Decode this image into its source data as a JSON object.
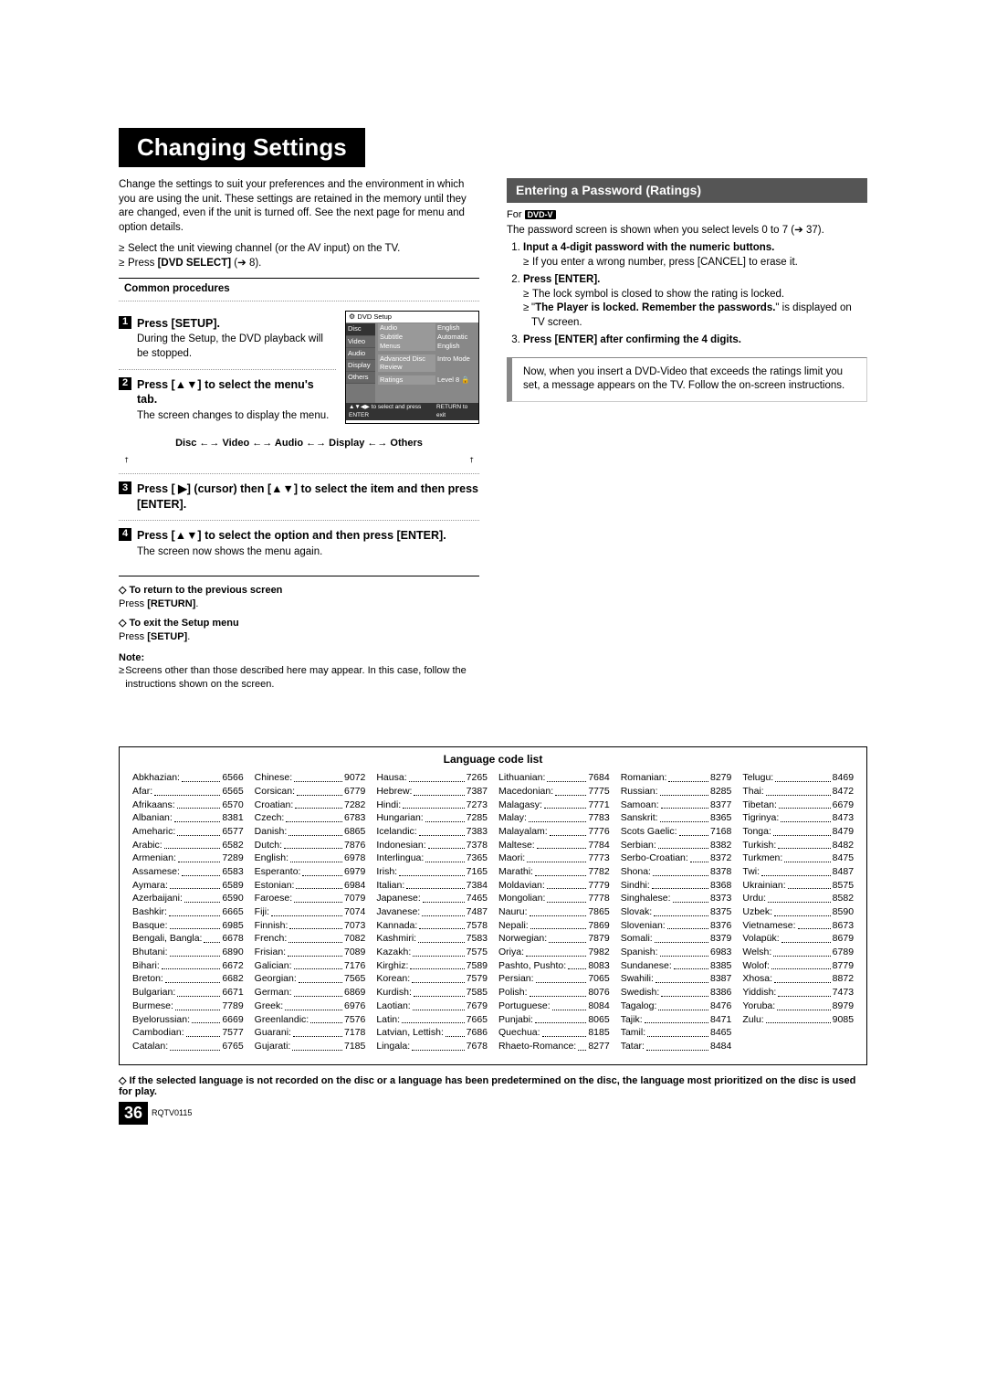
{
  "title": "Changing Settings",
  "intro": "Change the settings to suit your preferences and the environment in which you are using the unit. These settings are retained in the memory until they are changed, even if the unit is turned off. See the next page for menu and option details.",
  "intro_bullets": [
    "Select the unit viewing channel (or the AV input) on the TV.",
    "Press [DVD SELECT] (➔ 8)."
  ],
  "common_header": "Common procedures",
  "steps": [
    {
      "num": "1",
      "title": "Press [SETUP].",
      "body": "During the Setup, the DVD playback will be stopped."
    },
    {
      "num": "2",
      "title": "Press [▲▼] to select the menu's tab.",
      "body": "The screen changes to display the menu."
    },
    {
      "num": "3",
      "title": "Press [ ▶] (cursor) then [▲▼] to select the item and then press [ENTER].",
      "body": ""
    },
    {
      "num": "4",
      "title": "Press [▲▼] to select the option and then press [ENTER].",
      "body": "The screen now shows the menu again."
    }
  ],
  "flow": "Disc ←→ Video ←→ Audio ←→ Display ←→ Others",
  "returns": [
    {
      "head": "To return to the previous screen",
      "body": "Press [RETURN]."
    },
    {
      "head": "To exit the Setup menu",
      "body": "Press [SETUP]."
    }
  ],
  "note_label": "Note:",
  "note_body": "Screens other than those described here may appear. In this case, follow the instructions shown on the screen.",
  "osd": {
    "title": "DVD Setup",
    "tabs": [
      "Disc",
      "Video",
      "Audio",
      "Display",
      "Others"
    ],
    "lines": [
      {
        "label": "Audio",
        "value": "English"
      },
      {
        "label": "Subtitle",
        "value": "Automatic"
      },
      {
        "label": "Menus",
        "value": "English"
      },
      {
        "label": "Advanced Disc Review",
        "value": "Intro Mode"
      },
      {
        "label": "Ratings",
        "value": "Level 8 🔒"
      }
    ],
    "foot_left": "▲▼◀▶ to select and press ENTER",
    "foot_right": "RETURN to exit"
  },
  "right": {
    "heading": "Entering a Password (Ratings)",
    "for_label": "For",
    "dvdv": "DVD-V",
    "lead": "The password screen is shown when you select levels 0 to 7 (➔ 37).",
    "steps": [
      {
        "title": "Input a 4-digit password with the numeric buttons.",
        "subs": [
          "If you enter a wrong number, press [CANCEL] to erase it."
        ]
      },
      {
        "title": "Press [ENTER].",
        "subs": [
          "The lock symbol is closed to show the rating is locked.",
          "\"The Player is locked. Remember the passwords.\" is displayed on TV screen."
        ]
      },
      {
        "title": "Press [ENTER] after confirming the 4 digits.",
        "subs": []
      }
    ],
    "inset": "Now, when you insert a DVD-Video that exceeds the ratings limit you set, a message appears on the TV. Follow the on-screen instructions."
  },
  "lang_title": "Language code list",
  "languages": [
    [
      [
        "Abkhazian:",
        "6566"
      ],
      [
        "Afar:",
        "6565"
      ],
      [
        "Afrikaans:",
        "6570"
      ],
      [
        "Albanian:",
        "8381"
      ],
      [
        "Ameharic:",
        "6577"
      ],
      [
        "Arabic:",
        "6582"
      ],
      [
        "Armenian:",
        "7289"
      ],
      [
        "Assamese:",
        "6583"
      ],
      [
        "Aymara:",
        "6589"
      ],
      [
        "Azerbaijani:",
        "6590"
      ],
      [
        "Bashkir:",
        "6665"
      ],
      [
        "Basque:",
        "6985"
      ],
      [
        "Bengali, Bangla:",
        "6678"
      ],
      [
        "Bhutani:",
        "6890"
      ],
      [
        "Bihari:",
        "6672"
      ],
      [
        "Breton:",
        "6682"
      ],
      [
        "Bulgarian:",
        "6671"
      ],
      [
        "Burmese:",
        "7789"
      ],
      [
        "Byelorussian:",
        "6669"
      ],
      [
        "Cambodian:",
        "7577"
      ],
      [
        "Catalan:",
        "6765"
      ]
    ],
    [
      [
        "Chinese:",
        "9072"
      ],
      [
        "Corsican:",
        "6779"
      ],
      [
        "Croatian:",
        "7282"
      ],
      [
        "Czech:",
        "6783"
      ],
      [
        "Danish:",
        "6865"
      ],
      [
        "Dutch:",
        "7876"
      ],
      [
        "English:",
        "6978"
      ],
      [
        "Esperanto:",
        "6979"
      ],
      [
        "Estonian:",
        "6984"
      ],
      [
        "Faroese:",
        "7079"
      ],
      [
        "Fiji:",
        "7074"
      ],
      [
        "Finnish:",
        "7073"
      ],
      [
        "French:",
        "7082"
      ],
      [
        "Frisian:",
        "7089"
      ],
      [
        "Galician:",
        "7176"
      ],
      [
        "Georgian:",
        "7565"
      ],
      [
        "German:",
        "6869"
      ],
      [
        "Greek:",
        "6976"
      ],
      [
        "Greenlandic:",
        "7576"
      ],
      [
        "Guarani:",
        "7178"
      ],
      [
        "Gujarati:",
        "7185"
      ]
    ],
    [
      [
        "Hausa:",
        "7265"
      ],
      [
        "Hebrew:",
        "7387"
      ],
      [
        "Hindi:",
        "7273"
      ],
      [
        "Hungarian:",
        "7285"
      ],
      [
        "Icelandic:",
        "7383"
      ],
      [
        "Indonesian:",
        "7378"
      ],
      [
        "Interlingua:",
        "7365"
      ],
      [
        "Irish:",
        "7165"
      ],
      [
        "Italian:",
        "7384"
      ],
      [
        "Japanese:",
        "7465"
      ],
      [
        "Javanese:",
        "7487"
      ],
      [
        "Kannada:",
        "7578"
      ],
      [
        "Kashmiri:",
        "7583"
      ],
      [
        "Kazakh:",
        "7575"
      ],
      [
        "Kirghiz:",
        "7589"
      ],
      [
        "Korean:",
        "7579"
      ],
      [
        "Kurdish:",
        "7585"
      ],
      [
        "Laotian:",
        "7679"
      ],
      [
        "Latin:",
        "7665"
      ],
      [
        "Latvian, Lettish:",
        "7686"
      ],
      [
        "Lingala:",
        "7678"
      ]
    ],
    [
      [
        "Lithuanian:",
        "7684"
      ],
      [
        "Macedonian:",
        "7775"
      ],
      [
        "Malagasy:",
        "7771"
      ],
      [
        "Malay:",
        "7783"
      ],
      [
        "Malayalam:",
        "7776"
      ],
      [
        "Maltese:",
        "7784"
      ],
      [
        "Maori:",
        "7773"
      ],
      [
        "Marathi:",
        "7782"
      ],
      [
        "Moldavian:",
        "7779"
      ],
      [
        "Mongolian:",
        "7778"
      ],
      [
        "Nauru:",
        "7865"
      ],
      [
        "Nepali:",
        "7869"
      ],
      [
        "Norwegian:",
        "7879"
      ],
      [
        "Oriya:",
        "7982"
      ],
      [
        "Pashto, Pushto:",
        "8083"
      ],
      [
        "Persian:",
        "7065"
      ],
      [
        "Polish:",
        "8076"
      ],
      [
        "Portuguese:",
        "8084"
      ],
      [
        "Punjabi:",
        "8065"
      ],
      [
        "Quechua:",
        "8185"
      ],
      [
        "Rhaeto-Romance:",
        "8277"
      ]
    ],
    [
      [
        "Romanian:",
        "8279"
      ],
      [
        "Russian:",
        "8285"
      ],
      [
        "Samoan:",
        "8377"
      ],
      [
        "Sanskrit:",
        "8365"
      ],
      [
        "Scots Gaelic:",
        "7168"
      ],
      [
        "Serbian:",
        "8382"
      ],
      [
        "Serbo-Croatian:",
        "8372"
      ],
      [
        "Shona:",
        "8378"
      ],
      [
        "Sindhi:",
        "8368"
      ],
      [
        "Singhalese:",
        "8373"
      ],
      [
        "Slovak:",
        "8375"
      ],
      [
        "Slovenian:",
        "8376"
      ],
      [
        "Somali:",
        "8379"
      ],
      [
        "Spanish:",
        "6983"
      ],
      [
        "Sundanese:",
        "8385"
      ],
      [
        "Swahili:",
        "8387"
      ],
      [
        "Swedish:",
        "8386"
      ],
      [
        "Tagalog:",
        "8476"
      ],
      [
        "Tajik:",
        "8471"
      ],
      [
        "Tamil:",
        "8465"
      ],
      [
        "Tatar:",
        "8484"
      ]
    ],
    [
      [
        "Telugu:",
        "8469"
      ],
      [
        "Thai:",
        "8472"
      ],
      [
        "Tibetan:",
        "6679"
      ],
      [
        "Tigrinya:",
        "8473"
      ],
      [
        "Tonga:",
        "8479"
      ],
      [
        "Turkish:",
        "8482"
      ],
      [
        "Turkmen:",
        "8475"
      ],
      [
        "Twi:",
        "8487"
      ],
      [
        "Ukrainian:",
        "8575"
      ],
      [
        "Urdu:",
        "8582"
      ],
      [
        "Uzbek:",
        "8590"
      ],
      [
        "Vietnamese:",
        "8673"
      ],
      [
        "Volapük:",
        "8679"
      ],
      [
        "Welsh:",
        "6789"
      ],
      [
        "Wolof:",
        "8779"
      ],
      [
        "Xhosa:",
        "8872"
      ],
      [
        "Yiddish:",
        "7473"
      ],
      [
        "Yoruba:",
        "8979"
      ],
      [
        "Zulu:",
        "9085"
      ]
    ]
  ],
  "lang_footnote": "If the selected language is not recorded on the disc or a language has been predetermined on the disc, the language most prioritized on the disc is used for play.",
  "page_number": "36",
  "pub_code": "RQTV0115"
}
